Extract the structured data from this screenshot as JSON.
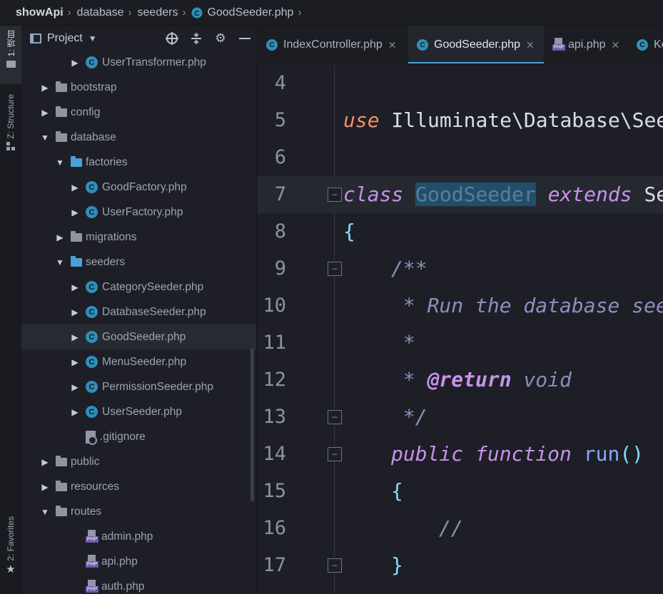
{
  "breadcrumb": {
    "root": "showApi",
    "items": [
      "database",
      "seeders",
      "GoodSeeder.php"
    ]
  },
  "toolstrip": {
    "project": "1: 项目",
    "structure": "Z: Structure",
    "favorites": "2: Favorites"
  },
  "project": {
    "title": "Project",
    "tools": [
      "target-icon",
      "collapse-icon",
      "gear-icon",
      "minimize-icon"
    ],
    "tree": [
      {
        "label": "UserTransformer.php",
        "kind": "class",
        "arrow": "▶"
      },
      {
        "label": "bootstrap",
        "kind": "folder",
        "arrow": "▶"
      },
      {
        "label": "config",
        "kind": "folder",
        "arrow": "▶"
      },
      {
        "label": "database",
        "kind": "folder",
        "arrow": "▼"
      },
      {
        "label": "factories",
        "kind": "folder-blue",
        "arrow": "▼"
      },
      {
        "label": "GoodFactory.php",
        "kind": "class",
        "arrow": "▶"
      },
      {
        "label": "UserFactory.php",
        "kind": "class",
        "arrow": "▶"
      },
      {
        "label": "migrations",
        "kind": "folder",
        "arrow": "▶"
      },
      {
        "label": "seeders",
        "kind": "folder-blue",
        "arrow": "▼"
      },
      {
        "label": "CategorySeeder.php",
        "kind": "class",
        "arrow": "▶"
      },
      {
        "label": "DatabaseSeeder.php",
        "kind": "class",
        "arrow": "▶"
      },
      {
        "label": "GoodSeeder.php",
        "kind": "class",
        "arrow": "▶"
      },
      {
        "label": "MenuSeeder.php",
        "kind": "class",
        "arrow": "▶"
      },
      {
        "label": "PermissionSeeder.php",
        "kind": "class",
        "arrow": "▶"
      },
      {
        "label": "UserSeeder.php",
        "kind": "class",
        "arrow": "▶"
      },
      {
        "label": ".gitignore",
        "kind": "git",
        "arrow": ""
      },
      {
        "label": "public",
        "kind": "folder",
        "arrow": "▶"
      },
      {
        "label": "resources",
        "kind": "folder",
        "arrow": "▶"
      },
      {
        "label": "routes",
        "kind": "folder",
        "arrow": "▼"
      },
      {
        "label": "admin.php",
        "kind": "php",
        "arrow": ""
      },
      {
        "label": "api.php",
        "kind": "php",
        "arrow": ""
      },
      {
        "label": "auth.php",
        "kind": "php",
        "arrow": ""
      }
    ]
  },
  "tabs": [
    {
      "label": "IndexController.php",
      "icon": "class-icon"
    },
    {
      "label": "GoodSeeder.php",
      "icon": "class-icon"
    },
    {
      "label": "api.php",
      "icon": "php-icon"
    },
    {
      "label": "Ke",
      "icon": "class-icon"
    }
  ],
  "editor": {
    "line_numbers": [
      "4",
      "5",
      "6",
      "7",
      "8",
      "9",
      "10",
      "11",
      "12",
      "13",
      "14",
      "15",
      "16",
      "17"
    ],
    "tokens": {
      "use_kw": "use",
      "use_path": " Illuminate\\Database\\See",
      "class_kw": "class",
      "class_name": "GoodSeeder",
      "extends_kw": " extends",
      "extends_name": " Se",
      "open_brace": "{",
      "doc_open": "/**",
      "doc_line1": " * Run the database see",
      "doc_line2": " *",
      "doc_star": " * ",
      "doc_tag": "@return",
      "doc_void": " void",
      "doc_close": " */",
      "public_kw": "public",
      "function_kw": " function",
      "fn_name": " run",
      "fn_parens": "()",
      "fn_open": "{",
      "fn_comment": "//",
      "fn_close": "}"
    }
  }
}
